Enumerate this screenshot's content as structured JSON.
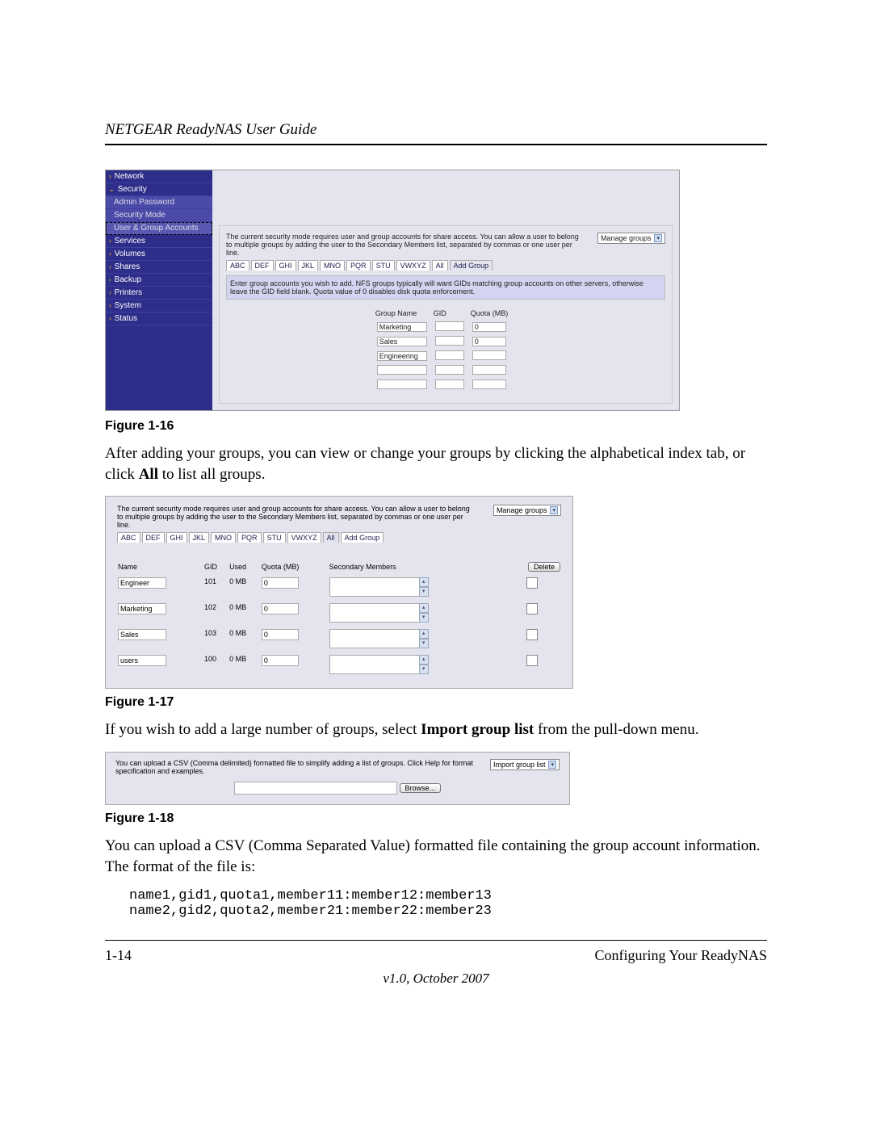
{
  "header": {
    "title": "NETGEAR ReadyNAS User Guide"
  },
  "sidebar": {
    "items": [
      {
        "label": "Network",
        "type": "parent"
      },
      {
        "label": "Security",
        "type": "open"
      },
      {
        "label": "Admin Password",
        "type": "sub"
      },
      {
        "label": "Security Mode",
        "type": "sub"
      },
      {
        "label": "User & Group Accounts",
        "type": "sub-active"
      },
      {
        "label": "Services",
        "type": "parent"
      },
      {
        "label": "Volumes",
        "type": "parent"
      },
      {
        "label": "Shares",
        "type": "parent"
      },
      {
        "label": "Backup",
        "type": "parent"
      },
      {
        "label": "Printers",
        "type": "parent"
      },
      {
        "label": "System",
        "type": "parent"
      },
      {
        "label": "Status",
        "type": "parent"
      }
    ]
  },
  "fig16": {
    "desc": "The current security mode requires user and group accounts for share access. You can allow a user to belong to multiple groups by adding the user to the Secondary Members list, separated by commas or one user per line.",
    "dropdown": "Manage groups",
    "tabs": [
      "ABC",
      "DEF",
      "GHI",
      "JKL",
      "MNO",
      "PQR",
      "STU",
      "VWXYZ",
      "All",
      "Add Group"
    ],
    "info": "Enter group accounts you wish to add. NFS groups typically will want GIDs matching group accounts on other servers, otherwise leave the GID field blank. Quota value of 0 disables disk quota enforcement.",
    "headers": {
      "name": "Group Name",
      "gid": "GID",
      "quota": "Quota (MB)"
    },
    "rows": [
      {
        "name": "Marketing",
        "gid": "",
        "quota": "0"
      },
      {
        "name": "Sales",
        "gid": "",
        "quota": "0"
      },
      {
        "name": "Engineering",
        "gid": "",
        "quota": ""
      },
      {
        "name": "",
        "gid": "",
        "quota": ""
      },
      {
        "name": "",
        "gid": "",
        "quota": ""
      }
    ],
    "caption": "Figure 1-16"
  },
  "para1": {
    "pre": "After adding your groups, you can view or change your groups by clicking the alphabetical index tab, or click ",
    "bold": "All",
    "post": " to list all groups."
  },
  "fig17": {
    "desc": "The current security mode requires user and group accounts for share access. You can allow a user to belong to multiple groups by adding the user to the Secondary Members list, separated by commas or one user per line.",
    "dropdown": "Manage groups",
    "tabs": [
      "ABC",
      "DEF",
      "GHI",
      "JKL",
      "MNO",
      "PQR",
      "STU",
      "VWXYZ",
      "All",
      "Add Group"
    ],
    "active_tab": "All",
    "headers": {
      "name": "Name",
      "gid": "GID",
      "used": "Used",
      "quota": "Quota (MB)",
      "members": "Secondary Members"
    },
    "delete": "Delete",
    "rows": [
      {
        "name": "Engineer",
        "gid": "101",
        "used": "0 MB",
        "quota": "0"
      },
      {
        "name": "Marketing",
        "gid": "102",
        "used": "0 MB",
        "quota": "0"
      },
      {
        "name": "Sales",
        "gid": "103",
        "used": "0 MB",
        "quota": "0"
      },
      {
        "name": "users",
        "gid": "100",
        "used": "0 MB",
        "quota": "0"
      }
    ],
    "caption": "Figure 1-17"
  },
  "para2": {
    "pre": "If you wish to add a large number of groups, select ",
    "bold": "Import group list",
    "post": " from the pull-down menu."
  },
  "fig18": {
    "desc": "You can upload a CSV (Comma delimited) formatted file to simplify adding a list of groups. Click Help for format specification and examples.",
    "dropdown": "Import group list",
    "browse": "Browse...",
    "caption": "Figure 1-18"
  },
  "para3": "You can upload a CSV (Comma Separated Value) formatted file containing the group account information. The format of the file is:",
  "code": "name1,gid1,quota1,member11:member12:member13\nname2,gid2,quota2,member21:member22:member23",
  "footer": {
    "page": "1-14",
    "section": "Configuring Your ReadyNAS",
    "version": "v1.0, October 2007"
  }
}
